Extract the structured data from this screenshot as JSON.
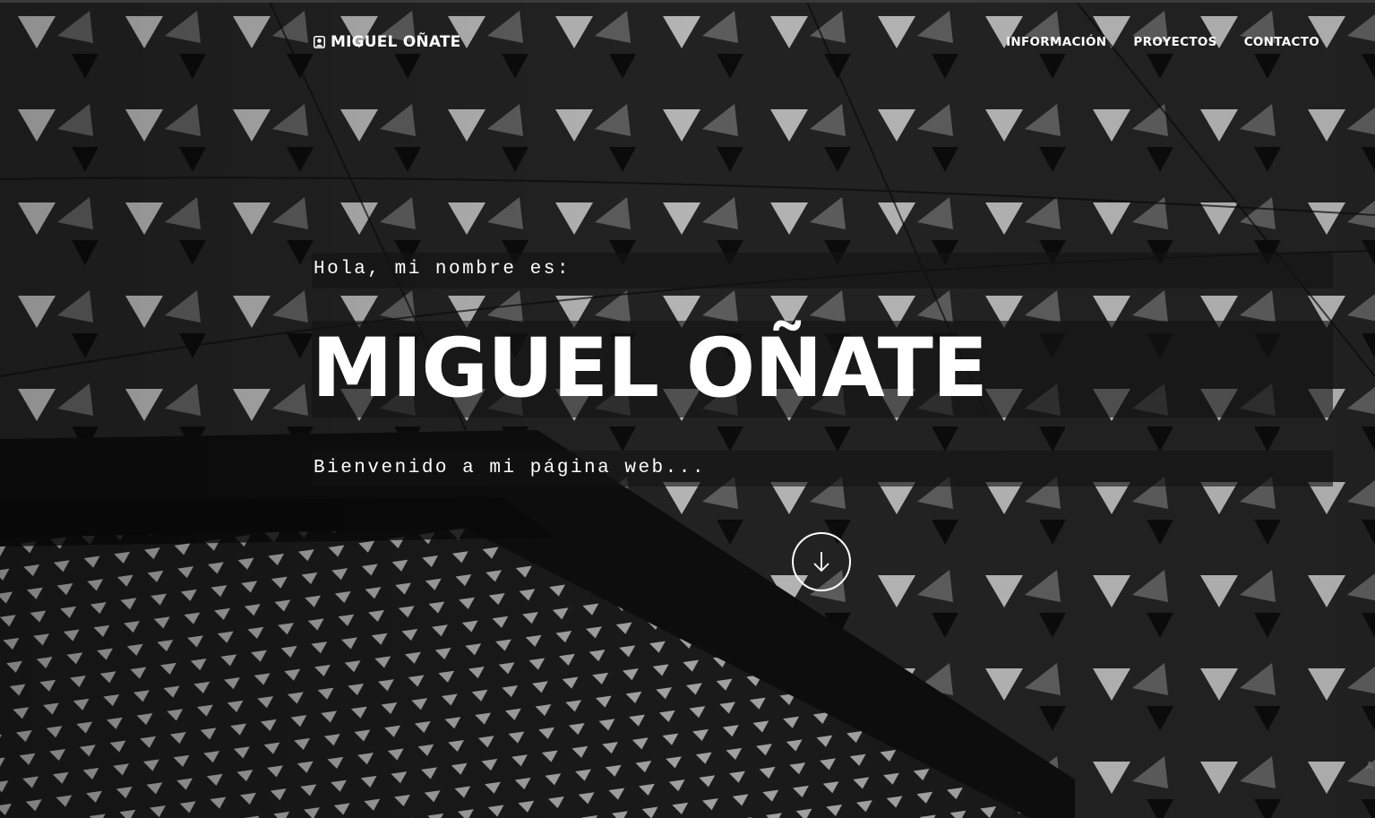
{
  "header": {
    "brand": "MIGUEL OÑATE",
    "brand_icon": "user-badge-icon",
    "nav": [
      {
        "label": "INFORMACIÓN"
      },
      {
        "label": "PROYECTOS"
      },
      {
        "label": "CONTACTO"
      }
    ]
  },
  "hero": {
    "greeting": "Hola, mi nombre es:",
    "name": "MIGUEL OÑATE",
    "welcome": "Bienvenido a mi página web...",
    "scroll_icon": "arrow-down-icon",
    "corner_glyph": "A"
  },
  "colors": {
    "text": "#ffffff",
    "background": "#1a1a1a",
    "band": "#141414"
  }
}
